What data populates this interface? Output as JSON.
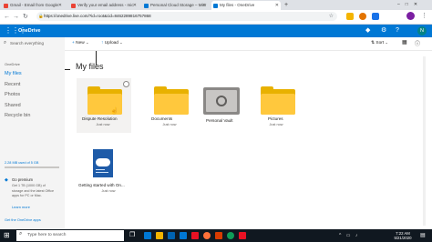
{
  "browser": {
    "tabs": [
      {
        "title": "Gmail - Email from Google",
        "color": "#ea4335"
      },
      {
        "title": "Verify your email address - mic",
        "color": "#ea4335"
      },
      {
        "title": "Personal Cloud Storage – Micr",
        "color": "#0078d4"
      },
      {
        "title": "My files - OneDrive",
        "color": "#0078d4"
      }
    ],
    "new_tab_icon": "plus-icon",
    "url": "https://onedrive.live.com/?id=root&cid=8462289816757868"
  },
  "onedrive": {
    "app_name": "OneDrive",
    "search_placeholder": "Search everything",
    "user_initial": "N",
    "sidebar": {
      "owner": "OneDrive",
      "items": [
        "My files",
        "Recent",
        "Photos",
        "Shared",
        "Recycle bin"
      ],
      "storage_text": "2.28 MB used of 5 GB",
      "premium_title": "Go premium",
      "premium_text": "Get 1 TB (1000 GB) of storage and the latest Office apps for PC or Mac.",
      "learn_more": "Learn more",
      "get_apps": "Get the OneDrive apps"
    },
    "commands": {
      "new": "New",
      "upload": "Upload",
      "sort": "Sort"
    },
    "title": "My files",
    "items": [
      {
        "name": "Dispute Resolution",
        "sub": "Just now",
        "type": "folder"
      },
      {
        "name": "Documents",
        "sub": "Just now",
        "type": "folder"
      },
      {
        "name": "Personal Vault",
        "sub": "",
        "type": "vault"
      },
      {
        "name": "Pictures",
        "sub": "Just now",
        "type": "folder"
      },
      {
        "name": "Getting started with On...",
        "sub": "Just now",
        "type": "pdf"
      }
    ]
  },
  "taskbar": {
    "search_placeholder": "Type here to search",
    "time": "7:22 AM",
    "date": "5/21/2020"
  }
}
